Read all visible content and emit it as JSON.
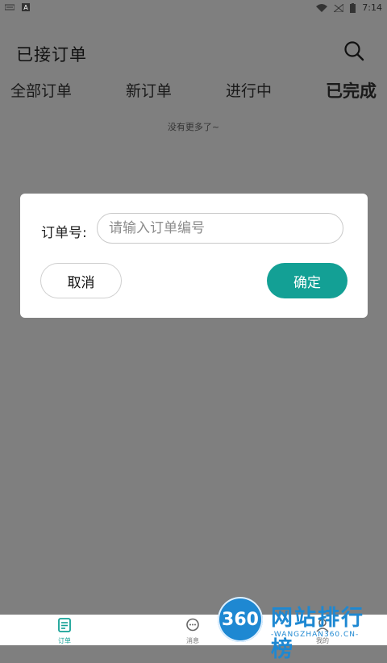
{
  "status_bar": {
    "time": "7:14"
  },
  "header": {
    "title": "已接订单"
  },
  "tabs": [
    {
      "label": "全部订单"
    },
    {
      "label": "新订单"
    },
    {
      "label": "进行中"
    },
    {
      "label": "已完成"
    }
  ],
  "active_tab_index": 3,
  "list": {
    "no_more_text": "没有更多了~"
  },
  "dialog": {
    "order_label": "订单号:",
    "order_placeholder": "请输入订单编号",
    "cancel_label": "取消",
    "confirm_label": "确定"
  },
  "bottom_nav": [
    {
      "label": "订单"
    },
    {
      "label": "消息"
    },
    {
      "label": "我的"
    }
  ],
  "watermark": {
    "circle_text": "360",
    "title": "网站排行榜",
    "subtitle": "-WANGZHAN360.CN-"
  },
  "colors": {
    "accent": "#13a095",
    "overlay": "#7f7f7f",
    "watermark": "#1e88d2"
  }
}
